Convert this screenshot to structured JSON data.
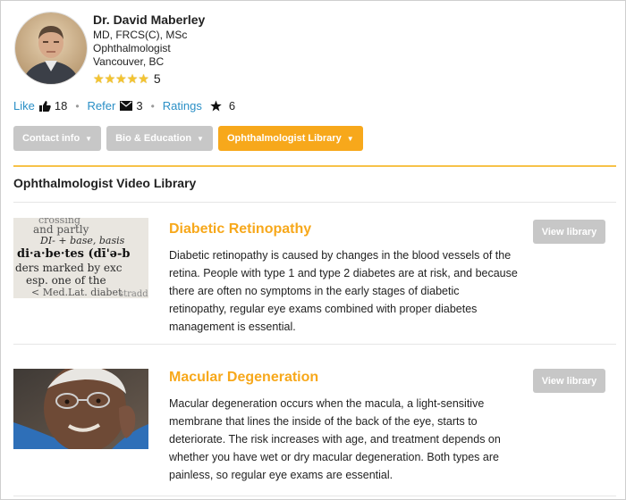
{
  "profile": {
    "name": "Dr. David Maberley",
    "credentials": "MD, FRCS(C), MSc",
    "specialty": "Ophthalmologist",
    "location": "Vancouver, BC",
    "rating": 5,
    "rating_text": "5"
  },
  "social": {
    "like_label": "Like",
    "like_count": "18",
    "refer_label": "Refer",
    "refer_count": "3",
    "ratings_label": "Ratings",
    "ratings_count": "6",
    "separator": "•"
  },
  "tabs": [
    {
      "label": "Contact info",
      "active": false
    },
    {
      "label": "Bio & Education",
      "active": false
    },
    {
      "label": "Ophthalmologist Library",
      "active": true
    }
  ],
  "section_title": "Ophthalmologist Video Library",
  "videos": [
    {
      "title": "Diabetic Retinopathy",
      "description": "Diabetic retinopathy is caused by changes in the blood vessels of the retina. People with type 1 and type 2 diabetes are at risk, and because there are often no symptoms in the early stages of diabetic retinopathy, regular eye exams combined with proper diabetes management is essential.",
      "button_label": "View library"
    },
    {
      "title": "Macular Degeneration",
      "description": "Macular degeneration occurs when the macula, a light-sensitive membrane that lines the inside of the back of the eye, starts to deteriorate. The risk increases with age, and treatment depends on whether you have wet or dry macular degeneration. Both types are painless, so regular eye exams are essential.",
      "button_label": "View library"
    }
  ],
  "thumb_dictionary_lines": [
    "crossing",
    "and partly",
    "DI- + base, basis",
    "di·a·be·tes (dī'ə-b",
    "ders marked by exc",
    "esp. one of the",
    "< Med.Lat. diabet",
    "straddle"
  ],
  "colors": {
    "accent": "#f7a81b",
    "link": "#2a8fc6",
    "button_gray": "#c7c7c7",
    "star": "#f4c430"
  },
  "icons": {
    "like": "thumbs-up-icon",
    "refer": "envelope-icon",
    "ratings": "star-icon",
    "tab_caret": "caret-down-icon"
  }
}
